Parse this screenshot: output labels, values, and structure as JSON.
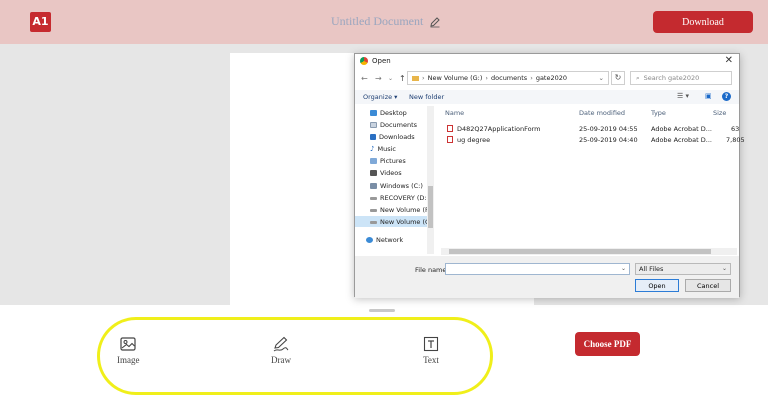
{
  "header": {
    "logo_text": "A1",
    "document_title": "Untitled Document",
    "download_label": "Download"
  },
  "tools": {
    "image_label": "Image",
    "draw_label": "Draw",
    "text_label": "Text",
    "choose_pdf_label": "Choose PDF",
    "highlight_color": "#f0ef1a"
  },
  "dialog": {
    "title": "Open",
    "close_glyph": "✕",
    "breadcrumb": [
      "New Volume (G:)",
      "documents",
      "gate2020"
    ],
    "search_placeholder": "Search gate2020",
    "toolbar": {
      "organize": "Organize ▾",
      "new_folder": "New folder"
    },
    "nav_items": [
      {
        "label": "Desktop",
        "icon": "desktop-icon"
      },
      {
        "label": "Documents",
        "icon": "documents-icon"
      },
      {
        "label": "Downloads",
        "icon": "downloads-icon"
      },
      {
        "label": "Music",
        "icon": "music-icon"
      },
      {
        "label": "Pictures",
        "icon": "pictures-icon"
      },
      {
        "label": "Videos",
        "icon": "videos-icon"
      },
      {
        "label": "Windows (C:)",
        "icon": "drive-icon"
      },
      {
        "label": "RECOVERY (D:)",
        "icon": "drive-icon"
      },
      {
        "label": "New Volume (F:)",
        "icon": "drive-icon"
      },
      {
        "label": "New Volume (G:",
        "icon": "drive-icon"
      },
      {
        "label": "Network",
        "icon": "network-icon"
      }
    ],
    "columns": {
      "name": "Name",
      "date": "Date modified",
      "type": "Type",
      "size": "Size"
    },
    "files": [
      {
        "name": "D482Q27ApplicationForm",
        "date": "25-09-2019 04:55",
        "type": "Adobe Acrobat D...",
        "size": "63"
      },
      {
        "name": "ug degree",
        "date": "25-09-2019 04:40",
        "type": "Adobe Acrobat D...",
        "size": "7,805"
      }
    ],
    "file_name_label": "File name:",
    "file_name_value": "",
    "filter_value": "All Files",
    "open_label": "Open",
    "cancel_label": "Cancel"
  }
}
